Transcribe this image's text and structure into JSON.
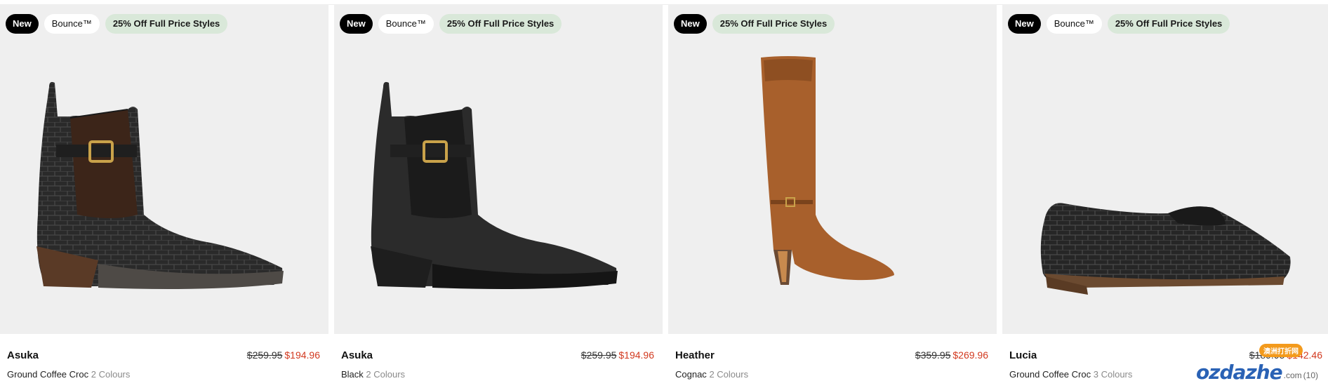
{
  "products": [
    {
      "badges": {
        "new": "New",
        "bounce": "Bounce™",
        "promo": "25% Off Full Price Styles"
      },
      "name": "Asuka",
      "was_price": "$259.95",
      "now_price": "$194.96",
      "colour": "Ground Coffee Croc",
      "colour_count": "2 Colours",
      "image_icon": "chelsea-boot-croc-icon"
    },
    {
      "badges": {
        "new": "New",
        "bounce": "Bounce™",
        "promo": "25% Off Full Price Styles"
      },
      "name": "Asuka",
      "was_price": "$259.95",
      "now_price": "$194.96",
      "colour": "Black",
      "colour_count": "2 Colours",
      "image_icon": "chelsea-boot-black-icon"
    },
    {
      "badges": {
        "new": "New",
        "promo": "25% Off Full Price Styles"
      },
      "name": "Heather",
      "was_price": "$359.95",
      "now_price": "$269.96",
      "colour": "Cognac",
      "colour_count": "2 Colours",
      "image_icon": "knee-high-boot-icon"
    },
    {
      "badges": {
        "new": "New",
        "bounce": "Bounce™",
        "promo": "25% Off Full Price Styles"
      },
      "name": "Lucia",
      "was_price": "$189.95",
      "now_price": "$142.46",
      "colour": "Ground Coffee Croc",
      "colour_count": "3 Colours",
      "image_icon": "loafer-croc-icon"
    }
  ],
  "watermark": {
    "logo": "ozdazhe",
    "suffix": ".com",
    "tag": "澳洲打折网",
    "extra": "(10)"
  },
  "colors": {
    "sale_price": "#d2391f",
    "promo_badge": "#d9e8d9",
    "image_bg": "#efefef"
  }
}
